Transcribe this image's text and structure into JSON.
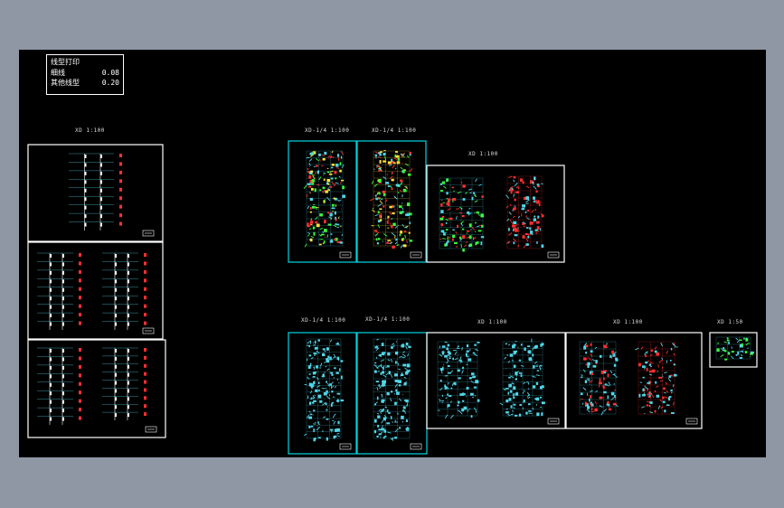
{
  "legend": {
    "title": "线型打印",
    "rows": [
      {
        "label": "细线",
        "value": "0.08"
      },
      {
        "label": "其他线型",
        "value": "0.20"
      }
    ]
  },
  "sheets": [
    {
      "title": "XD 1:100"
    },
    {
      "title": "XD-1/4 1:100"
    },
    {
      "title": "XD-1/4 1:100"
    },
    {
      "title": "XD 1:100"
    },
    {
      "title": "XD-1/4 1:100"
    },
    {
      "title": "XD-1/4 1:100"
    },
    {
      "title": "XD 1:100"
    },
    {
      "title": "XD 1:100"
    },
    {
      "title": "XD 1:50"
    }
  ],
  "colors": {
    "background": "#8f97a5",
    "canvas": "#000000",
    "frame_white": "#ffffff",
    "frame_cyan": "#00d4e0",
    "line_cyan": "#4fd6e8",
    "line_red": "#ff3030",
    "line_green": "#38ff3c",
    "line_yellow": "#ffe23a"
  }
}
